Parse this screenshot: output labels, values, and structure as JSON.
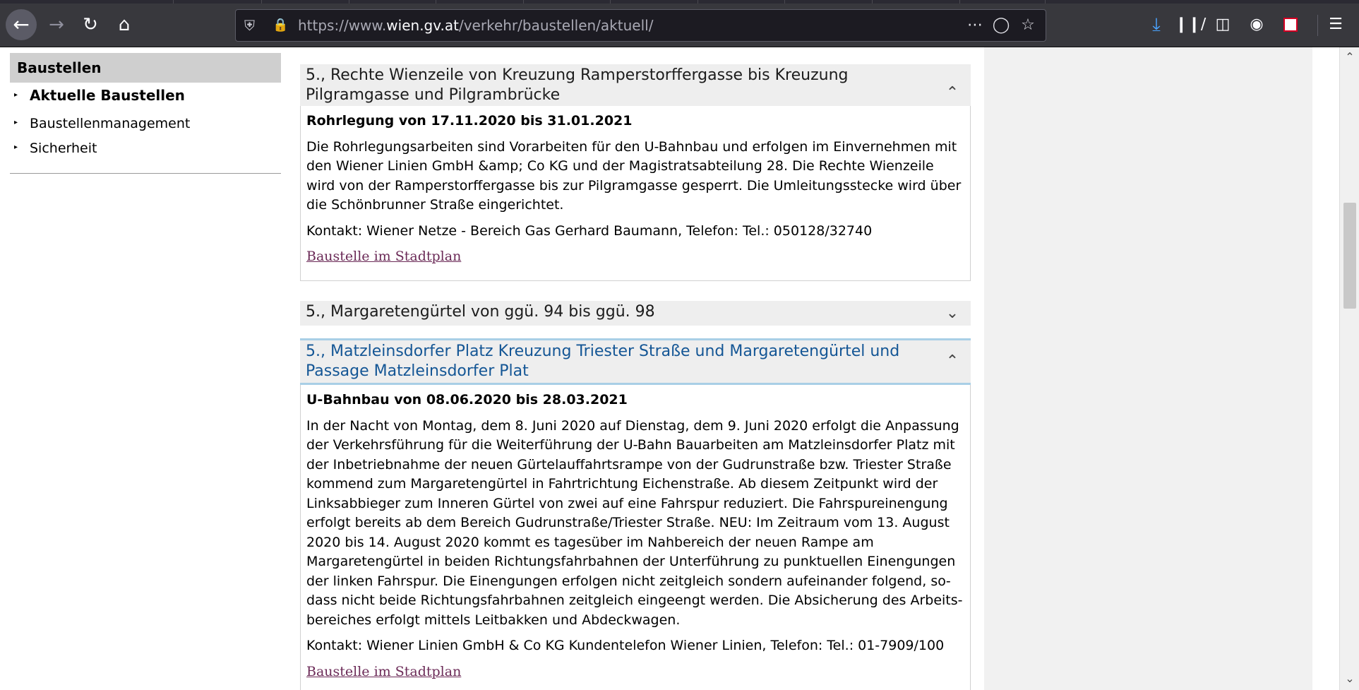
{
  "browser": {
    "url_prefix": "https://www.",
    "url_host": "wien.gv.at",
    "url_path": "/verkehr/baustellen/aktuell/",
    "icons": {
      "back": "back-arrow-icon",
      "forward": "forward-arrow-icon",
      "reload": "reload-icon",
      "home": "home-icon",
      "shield": "tracking-shield-icon",
      "lock": "lock-icon",
      "more": "more-actions-icon",
      "pocket": "pocket-icon",
      "star": "bookmark-star-icon",
      "downloads": "download-icon",
      "library": "library-icon",
      "sidebar": "sidebar-icon",
      "account": "account-icon",
      "extension": "extension-icon",
      "menu": "hamburger-menu-icon"
    }
  },
  "sidebar": {
    "heading": "Baustellen",
    "items": [
      {
        "label": "Aktuelle Baustellen",
        "active": true
      },
      {
        "label": "Baustellenmanagement",
        "active": false
      },
      {
        "label": "Sicherheit",
        "active": false
      }
    ]
  },
  "entries": [
    {
      "title": "5., Rechte Wienzeile von Kreuzung Ramperstorffergasse bis Kreuzung Pilgramgas­se und Pilgrambrücke",
      "expanded": true,
      "subtitle": "Rohrlegung von 17.11.2020 bis 31.01.2021",
      "description": "Die Rohrlegungsarbeiten sind Vorarbeiten für den U-Bahnbau und erfolgen im Einvernehmen mit den Wiener Linien GmbH &amp; Co KG und der Magistratsabteilung 28. Die Rechte Wienzeile wird von der Ramperstorffergasse bis zur Pilgramgasse gesperrt. Die Umleitungsstecke wird über die Schönbrunner Straße eingerichtet.",
      "contact": "Kontakt: Wiener Netze - Bereich Gas Gerhard Baumann, Telefon: Tel.: 050128/32740",
      "link": "Baustelle im Stadtplan"
    },
    {
      "title": "5., Margaretengürtel von ggü. 94 bis ggü. 98",
      "expanded": false
    },
    {
      "title": "5., Matzleinsdorfer Platz Kreuzung Triester Straße und Margaretengürtel und Pas­sage Matzleinsdorfer Plat",
      "expanded": true,
      "subtitle": "U-Bahnbau von 08.06.2020 bis 28.03.2021",
      "description": "In der Nacht von Montag, dem 8. Juni 2020 auf Dienstag, dem 9. Juni 2020 erfolgt die Anpas­sung der Verkehrsführung für die Weiterführung der U-Bahn Bauarbeiten am Matzleinsdorfer Platz mit der Inbetriebnahme der neuen Gürtelauffahrtsrampe von der Gudrunstraße bzw. Tries­ter Straße kommend zum Margaretengürtel in Fahrtrichtung Eichenstraße. Ab diesem Zeitpunkt wird der Linksabbieger zum Inneren Gürtel von zwei auf eine Fahrspur reduziert. Die Fahrspur­einengung erfolgt bereits ab dem Bereich Gudrunstraße/Triester Straße. NEU: Im Zeitraum vom 13. August 2020 bis 14. August 2020 kommt es tagesüber im Nahbereich der neuen Rampe am Margaretengürtel in beiden Richtungsfahrbahnen der Unterführung zu punktuellen Einengungen der linken Fahrspur. Die Einengungen erfolgen nicht zeitgleich sondern aufeinander folgend, so­dass nicht beide Richtungsfahrbahnen zeitgleich eingeengt werden. Die Absicherung des Arbeits­bereiches erfolgt mittels Leitbakken und Abdeckwagen.",
      "contact": "Kontakt: Wiener Linien GmbH & Co KG Kundentelefon Wiener Linien, Telefon: Tel.: 01-7909/100",
      "link": "Baustelle im Stadtplan"
    }
  ],
  "colors": {
    "chrome_bg": "#38383d",
    "urlbar_bg": "#1c1b22",
    "expanded_title_blue": "#145695",
    "link_visited": "#6b2a57",
    "sidebar_head_bg": "#cfcfcf"
  }
}
